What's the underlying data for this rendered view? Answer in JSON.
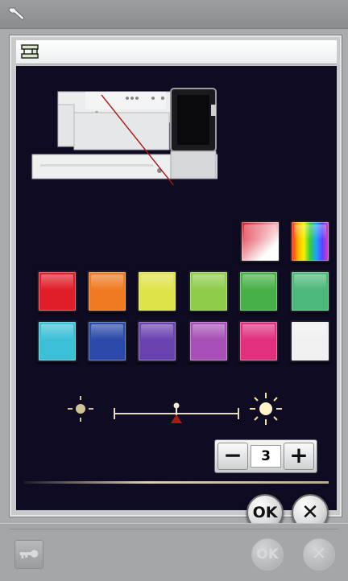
{
  "toolbar": {
    "icon": "wrench-icon"
  },
  "dialog": {
    "title_icon": "sewing-machine-icon",
    "illustration": "sewing-machine-illustration",
    "swatches_top": [
      {
        "name": "gradient-red-white",
        "colors": [
          "#d9182b",
          "#ffffff"
        ]
      },
      {
        "name": "rainbow",
        "colors": [
          "#ff2020",
          "#ffb000",
          "#f4f000",
          "#30d040",
          "#20a0ff",
          "#6040ff",
          "#e040c0"
        ]
      }
    ],
    "swatches_row1": [
      "#e01e2a",
      "#f07a22",
      "#dfe34a",
      "#8fcc4a",
      "#48b048",
      "#4cb87a"
    ],
    "swatches_row2": [
      "#3cc0d8",
      "#2a49a8",
      "#6a42b0",
      "#a850b8",
      "#e0307e",
      "#f0f0f0"
    ],
    "brightness": {
      "low_icon": "brightness-low-icon",
      "high_icon": "brightness-high-icon",
      "level_fraction": 0.5
    },
    "stepper": {
      "minus": "−",
      "value": "3",
      "plus": "+"
    },
    "ok_label": "OK",
    "cancel_label": "✕"
  },
  "bottombar": {
    "key_icon": "key-icon",
    "ok_label": "OK",
    "cancel_label": "✕"
  }
}
